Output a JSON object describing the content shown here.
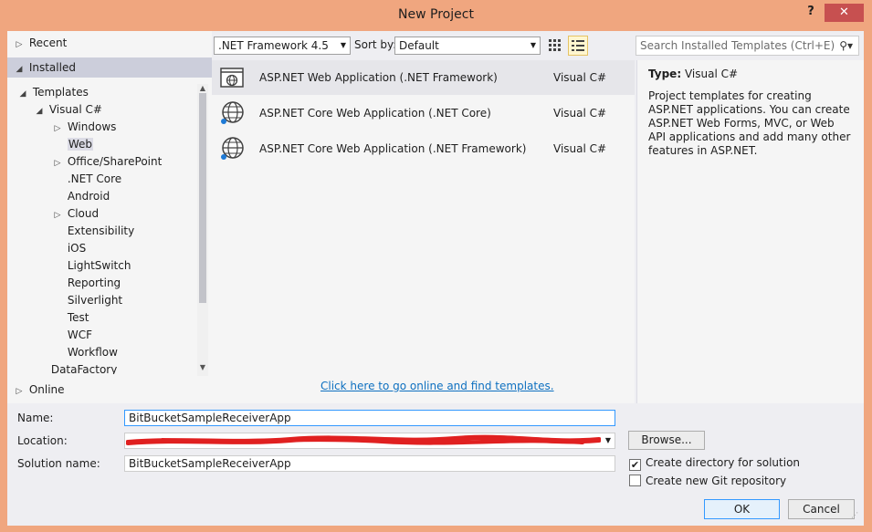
{
  "window": {
    "title": "New Project",
    "help_label": "?",
    "close_label": "✕"
  },
  "left": {
    "recent": "Recent",
    "installed": "Installed",
    "online": "Online",
    "tree": [
      {
        "label": "Templates",
        "arrow": "◢"
      },
      {
        "label": "Visual C#",
        "arrow": "◢"
      },
      {
        "label": "Windows",
        "arrow": "▷"
      },
      {
        "label": "Web",
        "arrow": ""
      },
      {
        "label": "Office/SharePoint",
        "arrow": "▷"
      },
      {
        "label": ".NET Core",
        "arrow": ""
      },
      {
        "label": "Android",
        "arrow": ""
      },
      {
        "label": "Cloud",
        "arrow": "▷"
      },
      {
        "label": "Extensibility",
        "arrow": ""
      },
      {
        "label": "iOS",
        "arrow": ""
      },
      {
        "label": "LightSwitch",
        "arrow": ""
      },
      {
        "label": "Reporting",
        "arrow": ""
      },
      {
        "label": "Silverlight",
        "arrow": ""
      },
      {
        "label": "Test",
        "arrow": ""
      },
      {
        "label": "WCF",
        "arrow": ""
      },
      {
        "label": "Workflow",
        "arrow": ""
      },
      {
        "label": "DataFactory",
        "arrow": ""
      }
    ]
  },
  "toolbar": {
    "framework": ".NET Framework 4.5",
    "sort_label": "Sort by:",
    "sort_value": "Default",
    "search_placeholder": "Search Installed Templates (Ctrl+E)"
  },
  "templates": [
    {
      "name": "ASP.NET Web Application (.NET Framework)",
      "lang": "Visual C#",
      "icon": "web-app-icon"
    },
    {
      "name": "ASP.NET Core Web Application (.NET Core)",
      "lang": "Visual C#",
      "icon": "globe-icon"
    },
    {
      "name": "ASP.NET Core Web Application (.NET Framework)",
      "lang": "Visual C#",
      "icon": "globe-icon"
    }
  ],
  "online_link": "Click here to go online and find templates.",
  "description": {
    "type_label": "Type:",
    "type_value": "Visual C#",
    "text": "Project templates for creating ASP.NET applications. You can create ASP.NET Web Forms, MVC, or Web API applications and add many other features in ASP.NET."
  },
  "form": {
    "name_label": "Name:",
    "name_value": "BitBucketSampleReceiverApp",
    "location_label": "Location:",
    "location_value": "",
    "solution_label": "Solution name:",
    "solution_value": "BitBucketSampleReceiverApp",
    "browse_label": "Browse...",
    "create_dir_label": "Create directory for solution",
    "create_dir_checked": true,
    "git_label": "Create new Git repository",
    "git_checked": false,
    "ok_label": "OK",
    "cancel_label": "Cancel"
  }
}
